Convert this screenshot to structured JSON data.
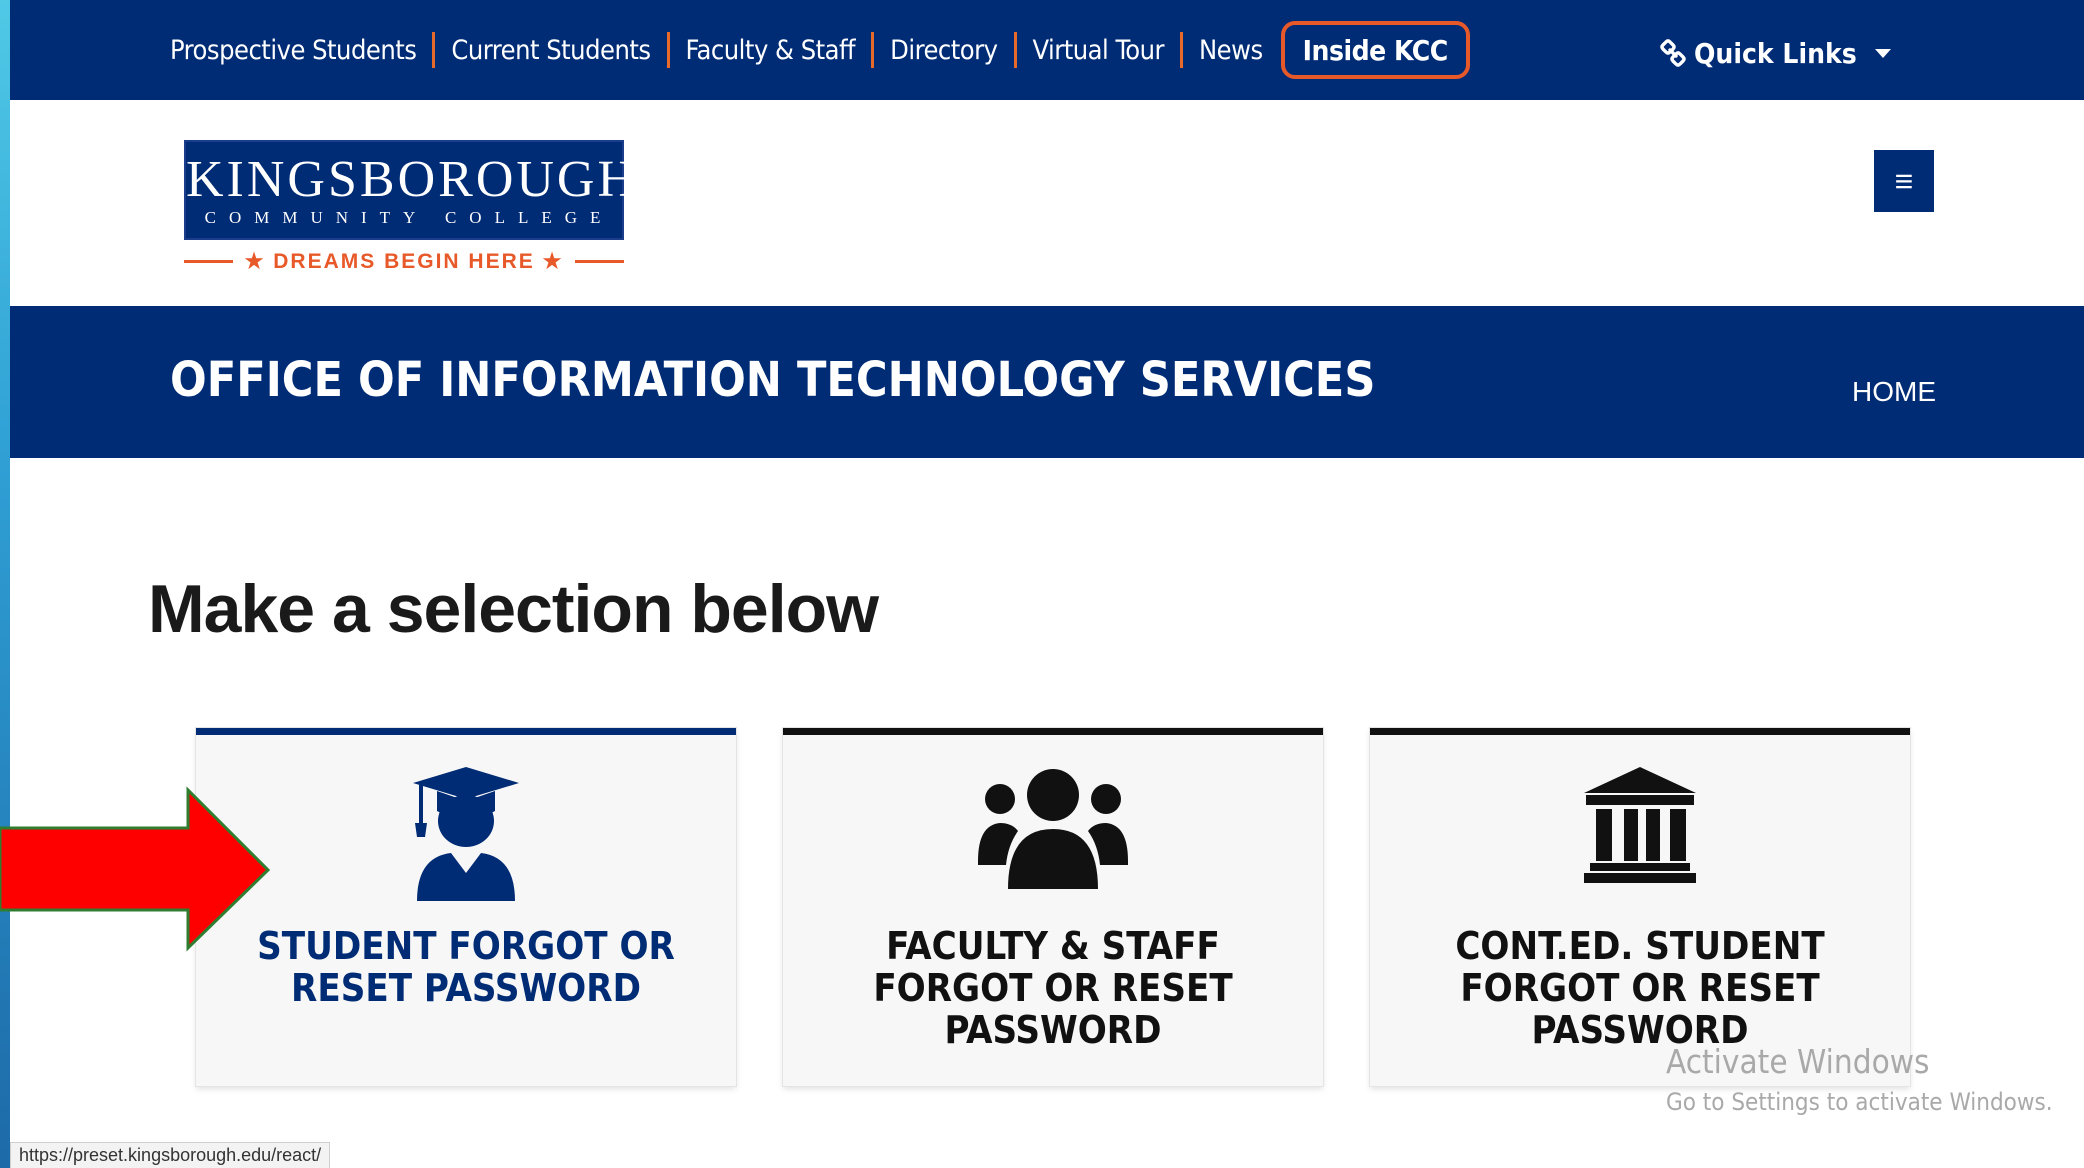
{
  "topnav": {
    "items": [
      "Prospective Students",
      "Current Students",
      "Faculty & Staff",
      "Directory",
      "Virtual Tour",
      "News"
    ],
    "inside_label": "Inside KCC",
    "quick_links_label": "Quick Links"
  },
  "logo": {
    "title": "KINGSBOROUGH",
    "subtitle": "COMMUNITY COLLEGE",
    "tagline": "★ DREAMS BEGIN HERE ★"
  },
  "menu_button_glyph": "≡",
  "banner": {
    "title": "OFFICE OF INFORMATION TECHNOLOGY SERVICES",
    "home_label": "HOME"
  },
  "main": {
    "heading": "Make a selection below",
    "cards": [
      {
        "label": "STUDENT FORGOT OR RESET PASSWORD",
        "icon": "graduate-icon"
      },
      {
        "label": "FACULTY & STAFF FORGOT OR RESET PASSWORD",
        "icon": "users-group-icon"
      },
      {
        "label": "CONT.ED. STUDENT FORGOT OR RESET PASSWORD",
        "icon": "institution-icon"
      }
    ]
  },
  "watermark": {
    "title": "Activate Windows",
    "subtitle": "Go to Settings to activate Windows."
  },
  "status_url": "https://preset.kingsborough.edu/react/",
  "colors": {
    "brand_navy": "#002b75",
    "accent_orange": "#e8592a",
    "arrow_red": "#ff0000"
  }
}
